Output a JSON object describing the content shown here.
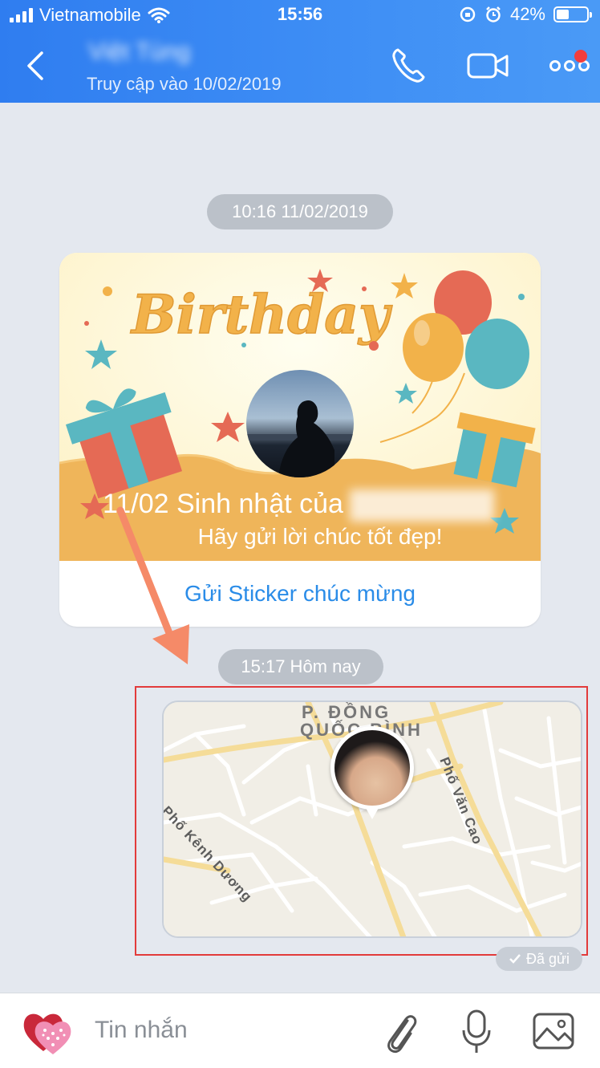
{
  "status_bar": {
    "carrier": "Vietnamobile",
    "time": "15:56",
    "battery": "42%",
    "battery_level": 0.42
  },
  "header": {
    "contact_name": "Việt Tùng",
    "last_seen": "Truy cập vào 10/02/2019"
  },
  "chat": {
    "timestamp_1": "10:16 11/02/2019",
    "birthday_card": {
      "art_title": "Birthday",
      "title_prefix": "11/02 Sinh nhật của",
      "title_name": "Việt Tùng",
      "subtitle": "Hãy gửi lời chúc tốt đẹp!",
      "action": "Gửi Sticker chúc mừng"
    },
    "timestamp_2": "15:17 Hôm nay",
    "location": {
      "district_line1": "P. ĐỒNG",
      "district_line2": "QUỐC BÌNH",
      "road_1": "Phố Kênh Dương",
      "road_2": "Phố Văn Cao"
    },
    "sent_status": "Đã gửi"
  },
  "input_bar": {
    "placeholder": "Tin nhắn"
  },
  "colors": {
    "header": "#3f8ff5",
    "link": "#2a8ce8",
    "card_orange": "#efb55a",
    "highlight": "#e23b3b"
  }
}
